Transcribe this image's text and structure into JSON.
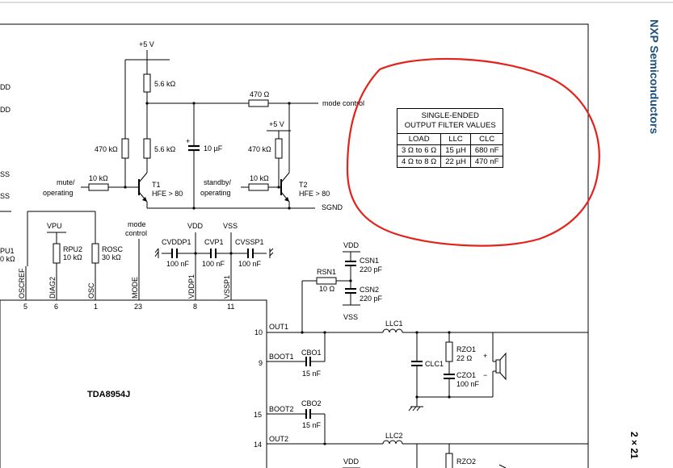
{
  "vendor": "NXP Semiconductors",
  "doc_title_partial": "2 × 21",
  "ic": {
    "name": "TDA8954J"
  },
  "left_edge_labels": [
    "DD",
    "DD",
    "SS",
    "SS",
    "PU1",
    "0 kΩ"
  ],
  "supply": {
    "plus5v_1": "+5 V",
    "plus5v_2": "+5 V",
    "vdd": "VDD",
    "vss": "VSS",
    "vpu": "VPU"
  },
  "resistors": {
    "r_56k_top": "5.6 kΩ",
    "r_56k_mid": "5.6 kΩ",
    "r_470k_left": "470 kΩ",
    "r_470_top": "470 Ω",
    "r_470k_right": "470 kΩ",
    "r_10k_mute": "10 kΩ",
    "r_10k_stby": "10 kΩ",
    "rpu2": "RPU2",
    "rpu2_val": "10 kΩ",
    "rosc": "ROSC",
    "rosc_val": "30 kΩ",
    "rsn1": "RSN1",
    "rsn1_val": "10 Ω",
    "rzo1": "RZO1",
    "rzo1_val": "22 Ω",
    "rzo2": "RZO2"
  },
  "capacitors": {
    "c_10u": "10 µF",
    "cvddp1": "CVDDP1",
    "cvddp1_val": "100 nF",
    "cvp1": "CVP1",
    "cvp1_val": "100 nF",
    "cvssp1": "CVSSP1",
    "cvssp1_val": "100 nF",
    "csn1": "CSN1",
    "csn1_val": "220 pF",
    "csn2": "CSN2",
    "csn2_val": "220 pF",
    "cbo1": "CBO1",
    "cbo1_val": "15 nF",
    "cbo2": "CBO2",
    "cbo2_val": "15 nF",
    "clc1": "CLC1",
    "czo1": "CZO1",
    "czo1_val": "100 nF"
  },
  "inductors": {
    "llc1": "LLC1",
    "llc2": "LLC2"
  },
  "transistors": {
    "t1": "T1",
    "t1_hfe": "HFE > 80",
    "t2": "T2",
    "t2_hfe": "HFE > 80"
  },
  "net_labels": {
    "mode_control": "mode control",
    "sgnd": "SGND",
    "mute_op_1": "mute/",
    "mute_op_2": "operating",
    "standby_op_1": "standby/",
    "standby_op_2": "operating",
    "mode_ctrl_1": "mode",
    "mode_ctrl_2": "control",
    "plus_sign": "+",
    "minus_sign": "−"
  },
  "pins": [
    {
      "name": "OSCREF",
      "num": "5"
    },
    {
      "name": "DIAG2",
      "num": "6"
    },
    {
      "name": "OSC",
      "num": "1"
    },
    {
      "name": "MODE",
      "num": "23"
    },
    {
      "name": "VDDP1",
      "num": "8"
    },
    {
      "name": "VSSP1",
      "num": "11"
    }
  ],
  "right_pins": [
    {
      "name": "OUT1",
      "num": "10"
    },
    {
      "name": "BOOT1",
      "num": "9"
    },
    {
      "name": "BOOT2",
      "num": "15"
    },
    {
      "name": "OUT2",
      "num": "14"
    }
  ],
  "filter_table": {
    "title_1": "SINGLE-ENDED",
    "title_2": "OUTPUT FILTER VALUES",
    "headers": [
      "LOAD",
      "LLC",
      "CLC"
    ],
    "rows": [
      [
        "3 Ω to 6 Ω",
        "15 µH",
        "680 nF"
      ],
      [
        "4 Ω to 8 Ω",
        "22 µH",
        "470 nF"
      ]
    ]
  },
  "annotation": {
    "color": "#e3221b"
  }
}
